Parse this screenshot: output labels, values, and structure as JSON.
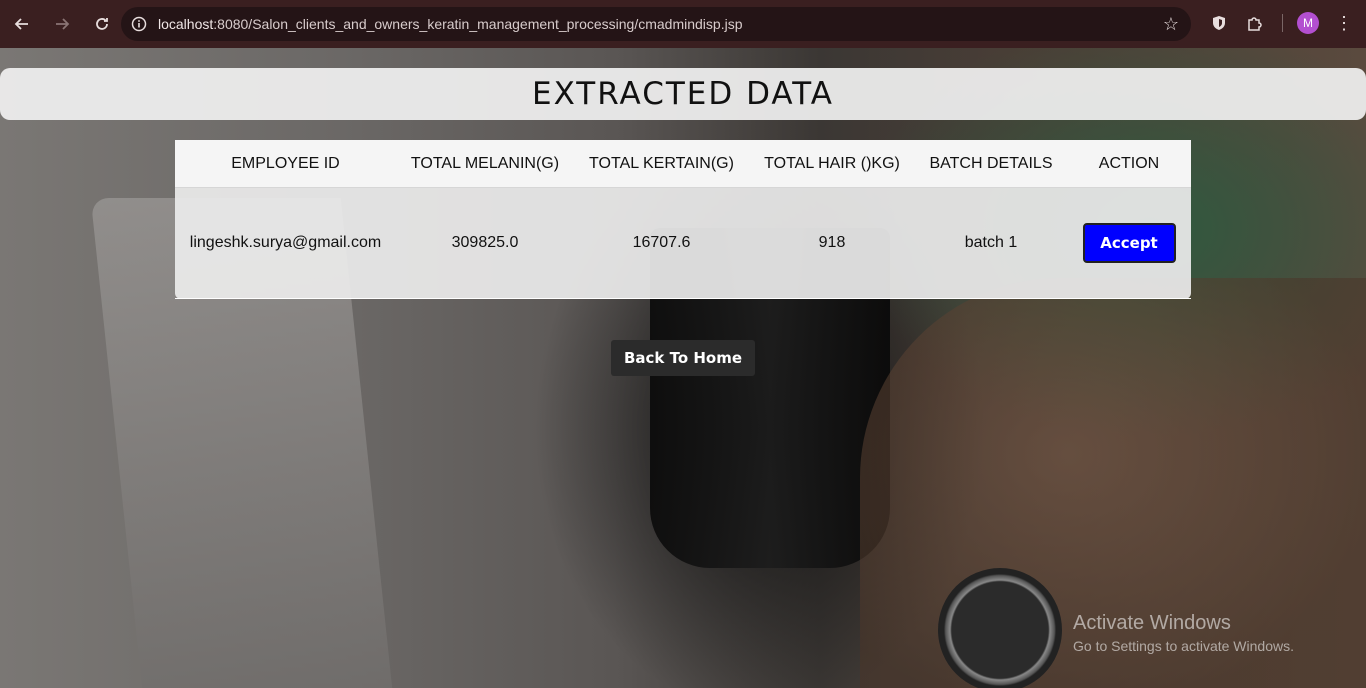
{
  "browser": {
    "url_host": "localhost",
    "url_rest": ":8080/Salon_clients_and_owners_keratin_management_processing/cmadmindisp.jsp",
    "avatar_letter": "M",
    "icons": [
      "back-arrow-icon",
      "forward-arrow-icon",
      "reload-icon",
      "site-info-icon",
      "bookmark-star-icon",
      "shield-extension-icon",
      "puzzle-extensions-icon",
      "kebab-menu-icon"
    ]
  },
  "page": {
    "title": "EXTRACTED DATA",
    "table": {
      "headers": [
        "EMPLOYEE ID",
        "TOTAL MELANIN(G)",
        "TOTAL KERTAIN(G)",
        "TOTAL HAIR ()KG)",
        "BATCH DETAILS",
        "ACTION"
      ],
      "rows": [
        {
          "employee_id": "lingeshk.surya@gmail.com",
          "melanin": "309825.0",
          "keratin": "16707.6",
          "hair": "918",
          "batch": "batch 1",
          "action": "Accept"
        }
      ]
    },
    "back_button": "Back To Home"
  },
  "overlay": {
    "activate_title": "Activate Windows",
    "activate_sub": "Go to Settings to activate Windows."
  },
  "colors": {
    "accept": "#0000ff",
    "back_button": "#2b2b2b",
    "chrome": "#3a1f20"
  }
}
